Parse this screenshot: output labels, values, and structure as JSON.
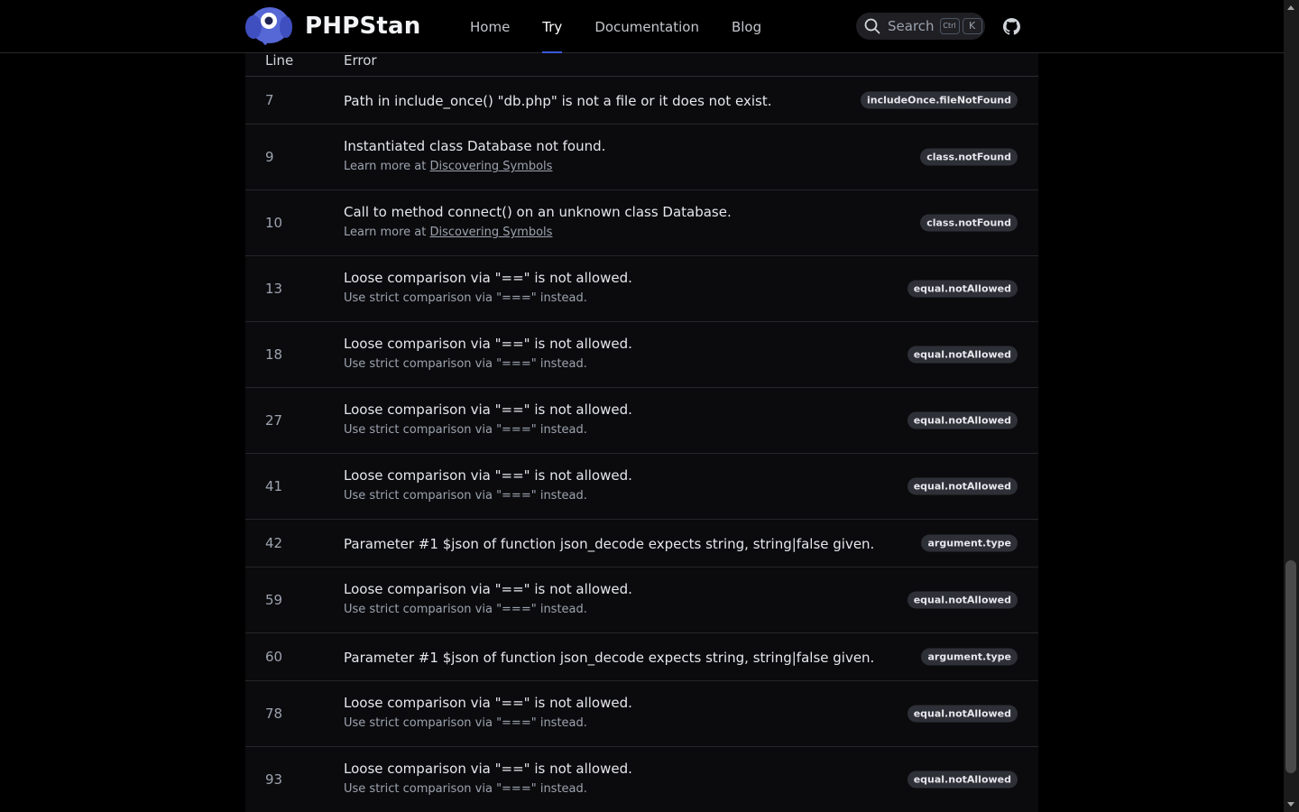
{
  "header": {
    "brand": "PHPStan",
    "nav": [
      {
        "label": "Home",
        "active": false
      },
      {
        "label": "Try",
        "active": true
      },
      {
        "label": "Documentation",
        "active": false
      },
      {
        "label": "Blog",
        "active": false
      }
    ],
    "search": {
      "label": "Search",
      "shortcut_mod": "Ctrl",
      "shortcut_key": "K"
    },
    "github_icon": "github-icon"
  },
  "table": {
    "headers": {
      "line": "Line",
      "error": "Error"
    },
    "rows": [
      {
        "line": "7",
        "message": "Path in include_once() \"db.php\" is not a file or it does not exist.",
        "tip_prefix": "",
        "tip_link": "",
        "tip_text": "",
        "identifier": "includeOnce.fileNotFound"
      },
      {
        "line": "9",
        "message": "Instantiated class Database not found.",
        "tip_prefix": "Learn more at ",
        "tip_link": "Discovering Symbols",
        "tip_text": "",
        "identifier": "class.notFound"
      },
      {
        "line": "10",
        "message": "Call to method connect() on an unknown class Database.",
        "tip_prefix": "Learn more at ",
        "tip_link": "Discovering Symbols",
        "tip_text": "",
        "identifier": "class.notFound"
      },
      {
        "line": "13",
        "message": "Loose comparison via \"==\" is not allowed.",
        "tip_prefix": "",
        "tip_link": "",
        "tip_text": "Use strict comparison via \"===\" instead.",
        "identifier": "equal.notAllowed"
      },
      {
        "line": "18",
        "message": "Loose comparison via \"==\" is not allowed.",
        "tip_prefix": "",
        "tip_link": "",
        "tip_text": "Use strict comparison via \"===\" instead.",
        "identifier": "equal.notAllowed"
      },
      {
        "line": "27",
        "message": "Loose comparison via \"==\" is not allowed.",
        "tip_prefix": "",
        "tip_link": "",
        "tip_text": "Use strict comparison via \"===\" instead.",
        "identifier": "equal.notAllowed"
      },
      {
        "line": "41",
        "message": "Loose comparison via \"==\" is not allowed.",
        "tip_prefix": "",
        "tip_link": "",
        "tip_text": "Use strict comparison via \"===\" instead.",
        "identifier": "equal.notAllowed"
      },
      {
        "line": "42",
        "message": "Parameter #1 $json of function json_decode expects string, string|false given.",
        "tip_prefix": "",
        "tip_link": "",
        "tip_text": "",
        "identifier": "argument.type"
      },
      {
        "line": "59",
        "message": "Loose comparison via \"==\" is not allowed.",
        "tip_prefix": "",
        "tip_link": "",
        "tip_text": "Use strict comparison via \"===\" instead.",
        "identifier": "equal.notAllowed"
      },
      {
        "line": "60",
        "message": "Parameter #1 $json of function json_decode expects string, string|false given.",
        "tip_prefix": "",
        "tip_link": "",
        "tip_text": "",
        "identifier": "argument.type"
      },
      {
        "line": "78",
        "message": "Loose comparison via \"==\" is not allowed.",
        "tip_prefix": "",
        "tip_link": "",
        "tip_text": "Use strict comparison via \"===\" instead.",
        "identifier": "equal.notAllowed"
      },
      {
        "line": "93",
        "message": "Loose comparison via \"==\" is not allowed.",
        "tip_prefix": "",
        "tip_link": "",
        "tip_text": "Use strict comparison via \"===\" instead.",
        "identifier": "equal.notAllowed"
      }
    ]
  },
  "colors": {
    "background": "#000000",
    "nav_active_underline": "#3b5bd9",
    "logo_blue": "#5b6bd8",
    "badge_bg": "#2e3038"
  }
}
